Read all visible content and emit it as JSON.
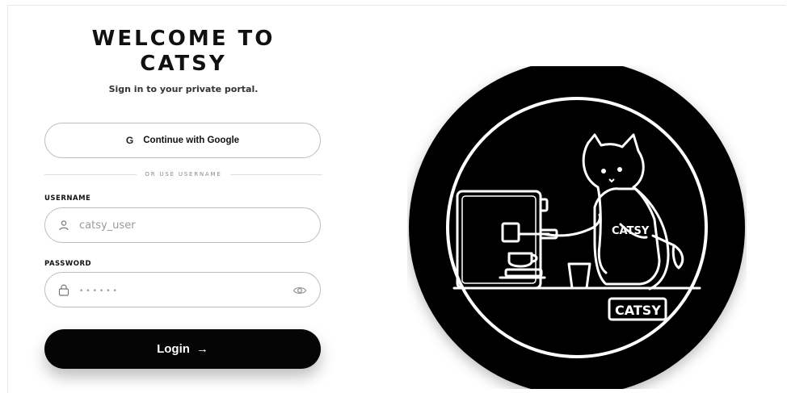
{
  "login": {
    "title_line1": "WELCOME TO",
    "title_line2": "CATSY",
    "subtitle": "Sign in to your private portal.",
    "google_icon": "G",
    "google_label": "Continue with Google",
    "divider_text": "OR USE USERNAME",
    "username_label": "USERNAME",
    "username_placeholder": "catsy_user",
    "password_label": "PASSWORD",
    "password_placeholder": "••••••",
    "login_label": "Login",
    "login_arrow": "→"
  },
  "illustration": {
    "apron_text": "CATSY",
    "sign_text": "CATSY"
  },
  "colors": {
    "accent": "#000000",
    "border": "#bdbdbd",
    "background": "#ffffff"
  }
}
